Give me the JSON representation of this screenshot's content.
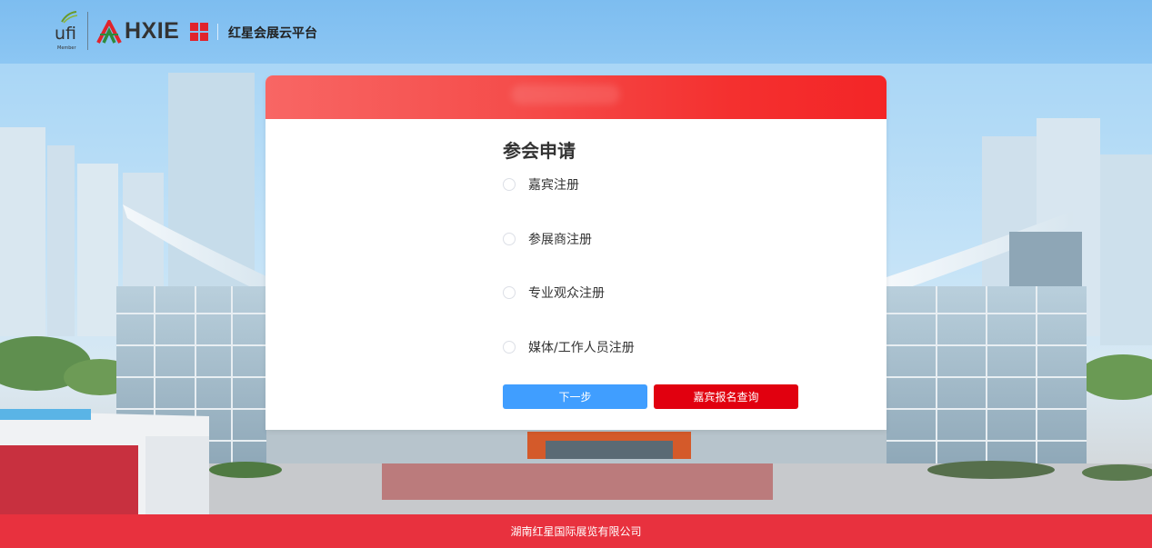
{
  "header": {
    "ufi_logo_text": "ufi",
    "ufi_logo_sub": "Member",
    "hxie_logo_text": "HXIE",
    "platform_name": "红星会展云平台"
  },
  "form": {
    "title": "参会申请",
    "options": [
      {
        "label": "嘉宾注册",
        "checked": false
      },
      {
        "label": "参展商注册",
        "checked": false
      },
      {
        "label": "专业观众注册",
        "checked": false
      },
      {
        "label": "媒体/工作人员注册",
        "checked": false
      }
    ],
    "next_button": "下一步",
    "query_button": "嘉宾报名查询"
  },
  "footer": {
    "company": "湖南红星国际展览有限公司"
  },
  "colors": {
    "header_bg": "#8cc6f3",
    "card_header": "#f32527",
    "primary_button": "#409eff",
    "secondary_button": "#e1000f",
    "footer_bg": "#e8313e"
  }
}
